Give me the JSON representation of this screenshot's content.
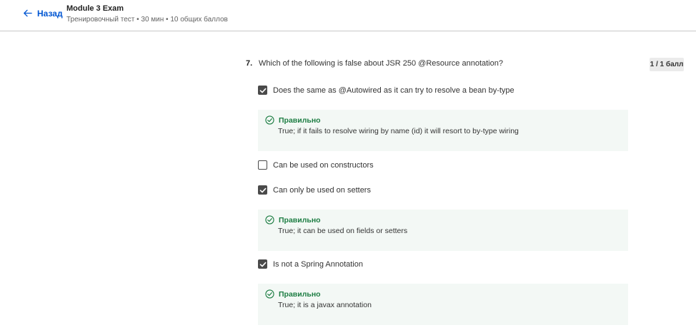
{
  "header": {
    "back_label": "Назад",
    "exam_title": "Module 3 Exam",
    "exam_subtitle": "Тренировочный тест • 30 мин • 10 общих баллов"
  },
  "question": {
    "number": "7.",
    "text": "Which of the following is false about  JSR 250 @Resource annotation?",
    "score": "1 / 1 балл"
  },
  "options": [
    {
      "label": "Does the same as @Autowired as it can try to resolve a bean by-type",
      "checked": true,
      "feedback": {
        "title": "Правильно",
        "text": "True; if it fails to resolve wiring by name (id) it will resort to by-type wiring"
      }
    },
    {
      "label": "Can be used on constructors",
      "checked": false
    },
    {
      "label": "Can only be used on setters",
      "checked": true,
      "feedback": {
        "title": "Правильно",
        "text": "True; it can be used on fields or setters"
      }
    },
    {
      "label": "Is not a Spring Annotation",
      "checked": true,
      "feedback": {
        "title": "Правильно",
        "text": "True; it is  a javax annotation"
      }
    }
  ],
  "colors": {
    "accent": "#0056d2",
    "correct": "#1e7e44",
    "feedback_bg": "#f3f8f5"
  }
}
